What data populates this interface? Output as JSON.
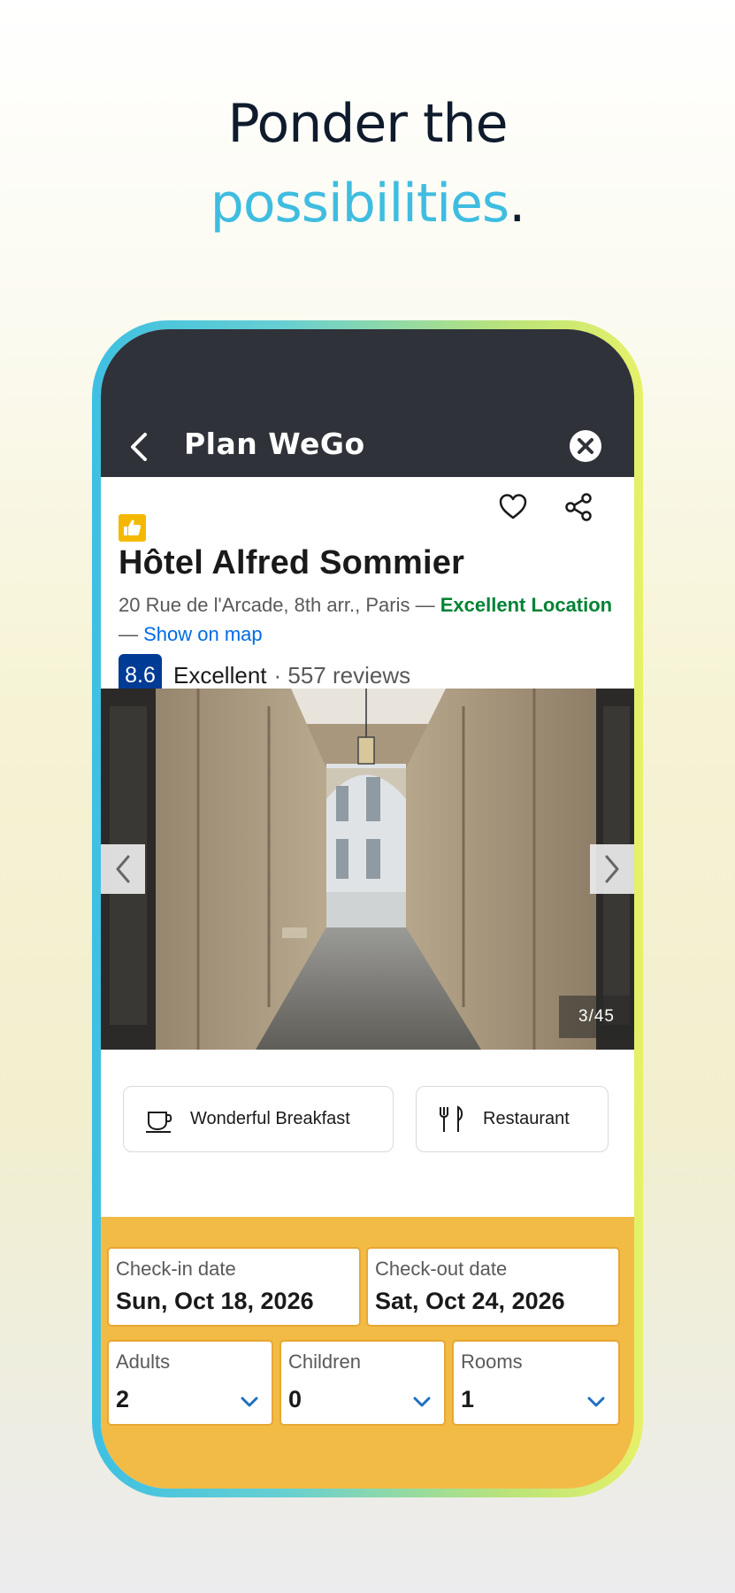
{
  "headline": {
    "line1": "Ponder the",
    "accent": "possibilities",
    "period": "."
  },
  "app": {
    "title": "Plan WeGo",
    "icons": {
      "back": "chevron-left-icon",
      "close": "close-circle-icon",
      "favorite": "heart-icon",
      "share": "share-icon",
      "badge": "thumbs-up-icon"
    }
  },
  "hotel": {
    "name": "Hôtel Alfred Sommier",
    "address": "20 Rue de l'Arcade, 8th arr., Paris —",
    "location_label": "Excellent Location",
    "separator": "—",
    "map_link": "Show on map",
    "score": "8.6",
    "rating_word": "Excellent",
    "reviews": "· 557 reviews"
  },
  "gallery": {
    "counter": "3/45"
  },
  "amenities": [
    {
      "label": "Wonderful Breakfast",
      "icon": "coffee-cup-icon"
    },
    {
      "label": "Restaurant",
      "icon": "fork-knife-icon"
    }
  ],
  "booking": {
    "checkin": {
      "label": "Check-in date",
      "value": "Sun, Oct 18, 2026"
    },
    "checkout": {
      "label": "Check-out date",
      "value": "Sat, Oct 24, 2026"
    },
    "adults": {
      "label": "Adults",
      "value": "2"
    },
    "children": {
      "label": "Children",
      "value": "0"
    },
    "rooms": {
      "label": "Rooms",
      "value": "1"
    }
  },
  "colors": {
    "accent": "#3fbde0",
    "topbar": "#2f3238",
    "booking_bg": "#f2bb46",
    "score_bg": "#003b95",
    "location_green": "#008234",
    "link_blue": "#006ce4"
  }
}
